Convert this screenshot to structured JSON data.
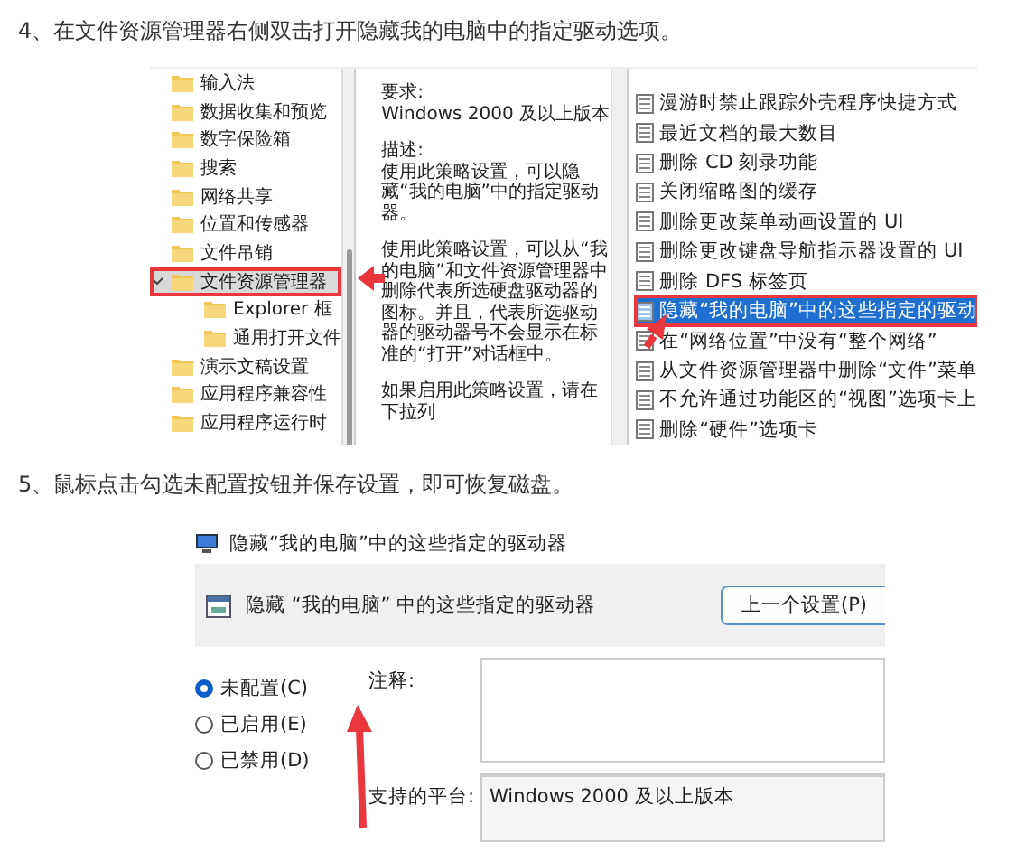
{
  "step_4": {
    "text": "4、在文件资源管理器右侧双击打开隐藏我的电脑中的指定驱动选项。"
  },
  "policy_editor": {
    "tree": [
      {
        "label": "输入法",
        "selected": false,
        "highlighted": false
      },
      {
        "label": "数据收集和预览",
        "selected": false,
        "highlighted": false
      },
      {
        "label": "数字保险箱",
        "selected": false,
        "highlighted": false
      },
      {
        "label": "搜索",
        "selected": false,
        "highlighted": false
      },
      {
        "label": "网络共享",
        "selected": false,
        "highlighted": false
      },
      {
        "label": "位置和传感器",
        "selected": false,
        "highlighted": false
      },
      {
        "label": "文件吊销",
        "selected": false,
        "highlighted": false
      },
      {
        "label": "文件资源管理器",
        "selected": true,
        "highlighted": true,
        "expanded": true,
        "children": [
          {
            "label": "Explorer 框",
            "selected": false,
            "highlighted": false
          },
          {
            "label": "通用打开文件",
            "selected": false,
            "highlighted": false
          }
        ]
      },
      {
        "label": "演示文稿设置",
        "selected": false,
        "highlighted": false
      },
      {
        "label": "应用程序兼容性",
        "selected": false,
        "highlighted": false
      },
      {
        "label": "应用程序运行时",
        "selected": false,
        "highlighted": false
      }
    ],
    "description": [
      {
        "heading": "要求:",
        "text": "Windows 2000 及以上版本"
      },
      {
        "heading": "描述:",
        "text": "使用此策略设置，可以隐藏“我的电脑”中的指定驱动器。"
      },
      {
        "text": "使用此策略设置，可以从“我的电脑”和文件资源管理器中删除代表所选硬盘驱动器的图标。并且，代表所选驱动器的驱动器号不会显示在标准的“打开”对话框中。"
      },
      {
        "text": "如果启用此策略设置，请在下拉列"
      }
    ],
    "settings": [
      {
        "label": "漫游时禁止跟踪外壳程序快捷方式",
        "selected": false,
        "highlighted": false
      },
      {
        "label": "最近文档的最大数目",
        "selected": false,
        "highlighted": false
      },
      {
        "label": "删除 CD 刻录功能",
        "selected": false,
        "highlighted": false
      },
      {
        "label": "关闭缩略图的缓存",
        "selected": false,
        "highlighted": false
      },
      {
        "label": "删除更改菜单动画设置的 UI",
        "selected": false,
        "highlighted": false
      },
      {
        "label": "删除更改键盘导航指示器设置的 UI",
        "selected": false,
        "highlighted": false
      },
      {
        "label": "删除 DFS 标签页",
        "selected": false,
        "highlighted": false
      },
      {
        "label": "隐藏“我的电脑”中的这些指定的驱动",
        "selected": true,
        "highlighted": true
      },
      {
        "label": "在“网络位置”中没有“整个网络”",
        "selected": false,
        "highlighted": false
      },
      {
        "label": "从文件资源管理器中删除“文件”菜单",
        "selected": false,
        "highlighted": false
      },
      {
        "label": "不允许通过功能区的“视图”选项卡上",
        "selected": false,
        "highlighted": false
      },
      {
        "label": "删除“硬件”选项卡",
        "selected": false,
        "highlighted": false
      }
    ]
  },
  "step_5": {
    "text": "5、鼠标点击勾选未配置按钮并保存设置，即可恢复磁盘。"
  },
  "policy_dialog": {
    "title": "隐藏“我的电脑”中的这些指定的驱动器",
    "heading": "隐藏 “我的电脑” 中的这些指定的驱动器",
    "previous_button": "上一个设置(P)",
    "options": [
      {
        "label": "未配置(C)",
        "selected": true
      },
      {
        "label": "已启用(E)",
        "selected": false
      },
      {
        "label": "已禁用(D)",
        "selected": false
      }
    ],
    "comment_label": "注释:",
    "platform_label": "支持的平台:",
    "platform_value": "Windows 2000 及以上版本"
  }
}
